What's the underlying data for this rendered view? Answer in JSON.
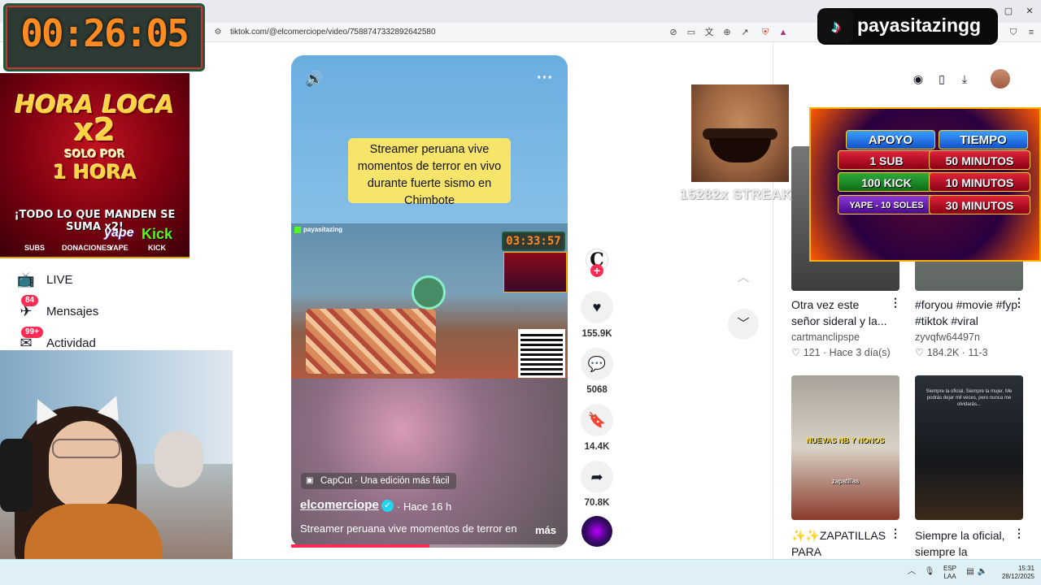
{
  "browser": {
    "url": "tiktok.com/@elcomerciope/video/7588747332892642580",
    "toolbar_icons": [
      "mute-icon",
      "cast-icon",
      "translate-icon",
      "zoom-icon",
      "share-icon",
      "brave-shields-icon",
      "rewards-icon",
      "menu-icon"
    ],
    "window_controls": [
      "minimize-icon",
      "maximize-icon",
      "close-icon"
    ]
  },
  "overlays": {
    "timer": "00:26:05",
    "promo": {
      "title": "HORA LOCA",
      "multiplier": "x2",
      "solo": "SOLO POR",
      "hora": "1 HORA",
      "todo": "¡TODO LO QUE MANDEN SE SUMA x2!",
      "labels": [
        "SUBS",
        "DONACIONES",
        "YAPE",
        "KICK"
      ],
      "yape": "yape",
      "kick": "Kick"
    },
    "streak": "15282x STREAK",
    "brand_name": "payasitazingg",
    "support": {
      "headers": [
        "APOYO",
        "TIEMPO"
      ],
      "rows": [
        {
          "apoyo": "1 SUB",
          "tiempo": "50 MINUTOS"
        },
        {
          "apoyo": "100 KICK",
          "tiempo": "10 MINUTOS"
        },
        {
          "apoyo": "YAPE - 10 SOLES",
          "tiempo": "30 MINUTOS"
        }
      ]
    }
  },
  "sidebar": {
    "items": [
      {
        "label": "LIVE",
        "icon": "live-tv-icon"
      },
      {
        "label": "Mensajes",
        "icon": "messages-icon",
        "badge": "84"
      },
      {
        "label": "Actividad",
        "icon": "activity-icon",
        "badge": "99+"
      }
    ]
  },
  "video": {
    "caption": "Streamer peruana vive momentos de terror en vivo durante fuerte sismo en Chimbote",
    "stream_timer": "03:33:57",
    "stream_channel": "payasitazing",
    "capcut_label": "CapCut · Una edición más fácil",
    "author": "elcomerciope",
    "posted": "· Hace 16 h",
    "description": "Streamer peruana vive momentos de terror en",
    "more": "más",
    "progress": 0.5
  },
  "actions": {
    "likes": "155.9K",
    "comments": "5068",
    "saves": "14.4K",
    "shares": "70.8K",
    "creator_initial": "C",
    "follow_symbol": "+"
  },
  "recommendations": [
    {
      "title": "Otra vez este señor sideral y la...",
      "author": "cartmanclipspe",
      "likes": "121",
      "when": "Hace 3 día(s)"
    },
    {
      "title": "#foryou #movie #fyp #tiktok #viral",
      "author": "zyvqfw64497n",
      "likes": "184.2K",
      "when": "11-3"
    },
    {
      "title": "✨✨ZAPATILLAS PARA ESTRENAR...",
      "thumb_text": "NUEVAS NB Y NONOS",
      "thumb_sub": "zapatillas"
    },
    {
      "title": "Siempre la oficial, siempre la mujer....",
      "thumb_text": "Siempre la oficial, Siempre la mujer. Me podrás dejar mil veces, pero nunca me olvidarás..."
    }
  ],
  "taskbar": {
    "lang_top": "ESP",
    "lang_bottom": "LAA",
    "time": "15:31",
    "date": "28/12/2025"
  },
  "colors": {
    "tiktok_red": "#fe2c55",
    "timer_orange": "#ff8a1f",
    "caption_yellow": "#f7e46a",
    "kick_green": "#53fc18"
  }
}
